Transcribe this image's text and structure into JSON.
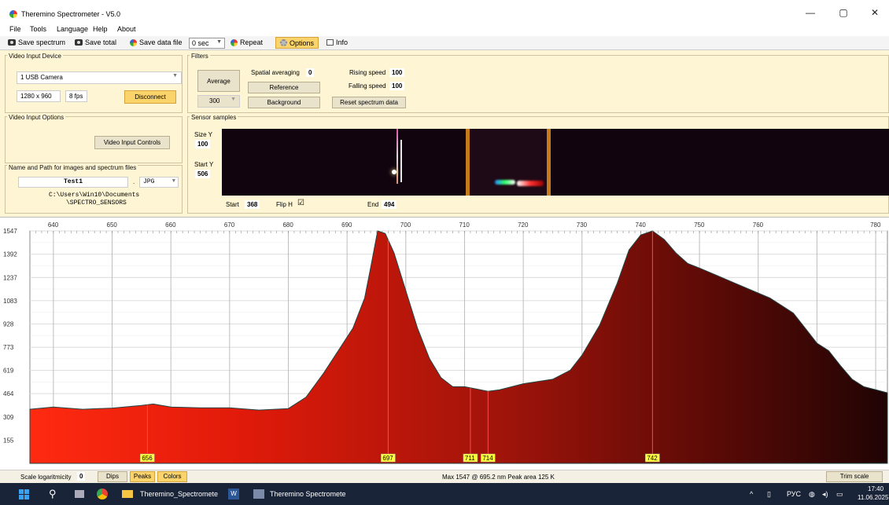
{
  "window": {
    "title": "Theremino Spectrometer - V5.0",
    "controls": [
      "—",
      "▢",
      "✕"
    ]
  },
  "menu": [
    "File",
    "Tools",
    "Language",
    "Help",
    "About"
  ],
  "toolbar": {
    "save_spectrum": "Save spectrum",
    "save_total": "Save total",
    "save_data_file": "Save data file",
    "interval": "0 sec",
    "repeat": "Repeat",
    "options": "Options",
    "info": "Info"
  },
  "video_input": {
    "title": "Video Input Device",
    "device": "1 USB Camera",
    "resolution": "1280 x 960",
    "fps": "8 fps",
    "disconnect": "Disconnect"
  },
  "video_options": {
    "title": "Video Input Options",
    "controls_button": "Video Input Controls"
  },
  "files": {
    "title": "Name and Path for images and spectrum files",
    "name": "Test1",
    "dot": ".",
    "ext": "JPG",
    "path_line1": "C:\\Users\\Win10\\Documents",
    "path_line2": "\\SPECTRO_SENSORS"
  },
  "filters": {
    "title": "Filters",
    "average": "Average",
    "average_value": "300",
    "spatial_label": "Spatial averaging",
    "spatial_value": "0",
    "reference": "Reference",
    "background": "Background",
    "rising_label": "Rising speed",
    "rising_value": "100",
    "falling_label": "Falling speed",
    "falling_value": "100",
    "reset": "Reset spectrum data"
  },
  "sensor": {
    "title": "Sensor samples",
    "size_y_label": "Size Y",
    "size_y": "100",
    "start_y_label": "Start Y",
    "start_y": "506",
    "start_label": "Start",
    "start": "368",
    "flip_label": "Flip H",
    "flip_check": "☑",
    "end_label": "End",
    "end": "494"
  },
  "chart_data": {
    "type": "area",
    "x_range": [
      636,
      782
    ],
    "y_range": [
      0,
      1547
    ],
    "x_ticks": [
      640,
      650,
      660,
      670,
      680,
      690,
      700,
      710,
      720,
      730,
      740,
      750,
      760,
      770,
      780
    ],
    "x_tick_labels": [
      "640",
      "650",
      "660",
      "670",
      "680",
      "690",
      "700",
      "710",
      "720",
      "730",
      "740",
      "750",
      "760",
      "780"
    ],
    "y_ticks": [
      "1547",
      "1392",
      "1237",
      "1083",
      "928",
      "773",
      "619",
      "464",
      "309",
      "155"
    ],
    "series": [
      {
        "x": [
          636,
          640,
          645,
          650,
          655,
          657,
          660,
          665,
          670,
          675,
          680,
          683,
          686,
          689,
          691,
          693,
          694,
          695.2,
          696.5,
          698,
          700,
          702,
          704,
          706,
          708,
          710,
          712,
          714,
          716,
          720,
          725,
          728,
          730,
          733,
          736,
          738,
          740,
          742,
          744,
          746,
          748,
          750,
          753,
          756,
          759,
          762,
          764,
          766,
          768,
          770,
          772,
          774,
          776,
          778,
          780,
          782
        ],
        "y": [
          360,
          375,
          360,
          368,
          385,
          395,
          375,
          370,
          370,
          355,
          365,
          440,
          600,
          780,
          900,
          1100,
          1300,
          1547,
          1530,
          1400,
          1150,
          900,
          700,
          570,
          510,
          510,
          495,
          480,
          490,
          530,
          560,
          620,
          720,
          920,
          1200,
          1420,
          1520,
          1547,
          1490,
          1400,
          1330,
          1300,
          1250,
          1200,
          1150,
          1100,
          1050,
          1000,
          900,
          800,
          750,
          650,
          560,
          510,
          490,
          470
        ]
      }
    ],
    "peaks": [
      {
        "x": 656,
        "label": "656"
      },
      {
        "x": 697,
        "label": "697"
      },
      {
        "x": 711,
        "label": "711"
      },
      {
        "x": 714,
        "label": "714"
      },
      {
        "x": 742,
        "label": "742"
      }
    ],
    "grid": true
  },
  "status": {
    "scale_label": "Scale logaritmicity",
    "scale_value": "0",
    "dips": "Dips",
    "peaks": "Peaks",
    "colors": "Colors",
    "readout": "Max 1547 @ 695.2 nm  Peak area 125 K",
    "trim": "Trim scale"
  },
  "taskbar": {
    "explorer_item": "Theremino_Spectromete",
    "app_item": "Theremino Spectromete",
    "lang": "РУС",
    "time": "17:40",
    "date": "11.06.2025"
  }
}
